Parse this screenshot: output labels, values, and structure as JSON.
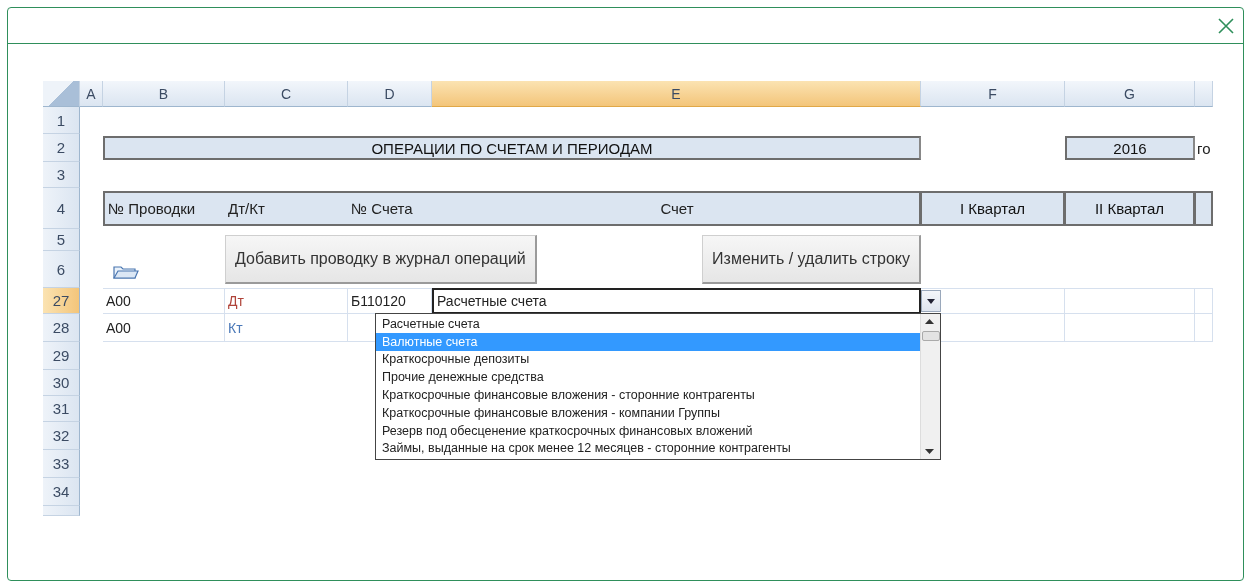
{
  "sheet": {
    "columns": [
      {
        "label": "A",
        "selected": false
      },
      {
        "label": "B",
        "selected": false
      },
      {
        "label": "C",
        "selected": false
      },
      {
        "label": "D",
        "selected": false
      },
      {
        "label": "E",
        "selected": true
      },
      {
        "label": "F",
        "selected": false
      },
      {
        "label": "G",
        "selected": false
      }
    ],
    "row_numbers": [
      {
        "label": "1",
        "selected": false
      },
      {
        "label": "2",
        "selected": false
      },
      {
        "label": "3",
        "selected": false
      },
      {
        "label": "4",
        "selected": false
      },
      {
        "label": "5",
        "selected": false
      },
      {
        "label": "6",
        "selected": false
      },
      {
        "label": "27",
        "selected": true
      },
      {
        "label": "28",
        "selected": false
      },
      {
        "label": "29",
        "selected": false
      },
      {
        "label": "30",
        "selected": false
      },
      {
        "label": "31",
        "selected": false
      },
      {
        "label": "32",
        "selected": false
      },
      {
        "label": "33",
        "selected": false
      },
      {
        "label": "34",
        "selected": false
      }
    ],
    "title": "ОПЕРАЦИИ ПО СЧЕТАМ И ПЕРИОДАМ",
    "year": "2016",
    "year_suffix": "го",
    "header_cells": [
      "№ Проводки",
      "Дт/Кт",
      "№ Счета",
      "Счет"
    ],
    "quarter_cells": [
      "I Квартал",
      "II Квартал"
    ],
    "buttons": [
      "Добавить проводку в журнал операций",
      "Изменить / удалить строку"
    ],
    "rows": [
      {
        "entry": "А00",
        "side": "Дт",
        "color": "#b0443a",
        "account_no": "Б110120",
        "account": "Расчетные счета"
      },
      {
        "entry": "А00",
        "side": "Кт",
        "color": "#4a78b8"
      }
    ],
    "dropdown": {
      "items": [
        {
          "label": "Расчетные счета",
          "selected": false
        },
        {
          "label": "Валютные счета",
          "selected": true
        },
        {
          "label": "Краткосрочные депозиты",
          "selected": false
        },
        {
          "label": "Прочие денежные средства",
          "selected": false
        },
        {
          "label": "Краткосрочные финансовые вложения - сторонние контрагенты",
          "selected": false
        },
        {
          "label": "Краткосрочные финансовые вложения - компании Группы",
          "selected": false
        },
        {
          "label": "Резерв под обесценение краткосрочных финансовых вложений",
          "selected": false
        },
        {
          "label": "Займы, выданные на срок менее 12 месяцев - сторонние контрагенты",
          "selected": false
        }
      ]
    }
  }
}
